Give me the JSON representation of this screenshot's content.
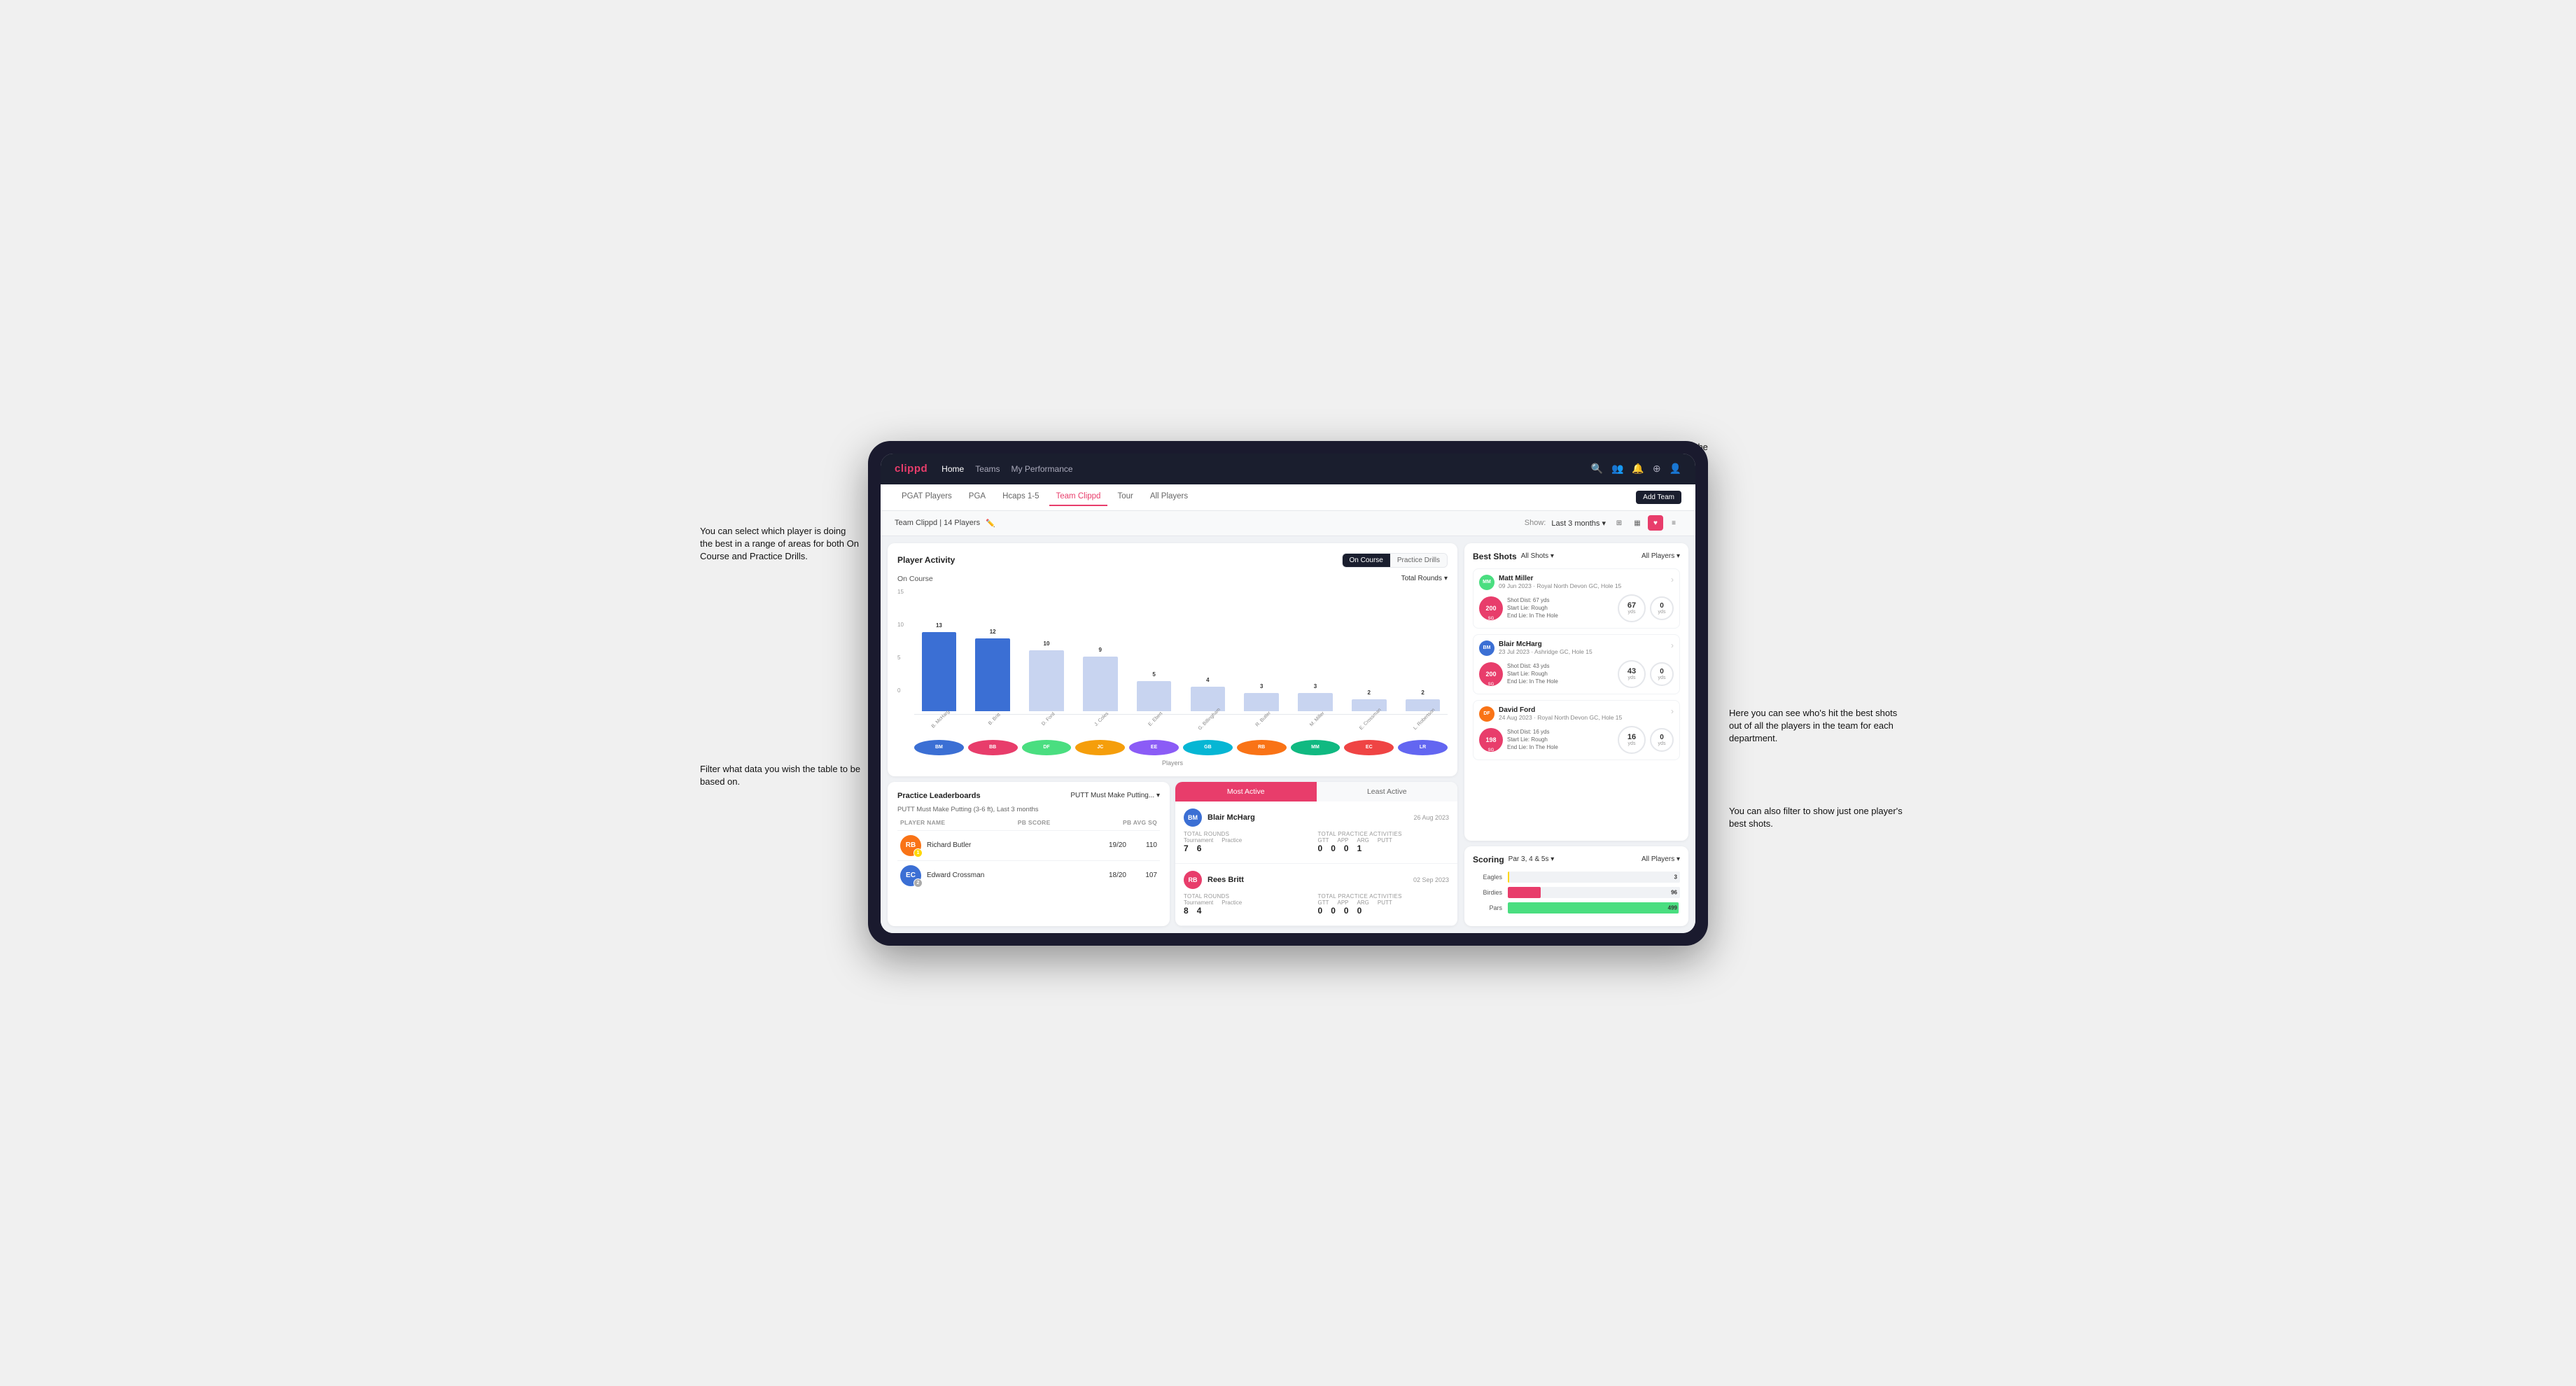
{
  "annotations": {
    "top_right": "Choose the timescale you wish to see the data over.",
    "left_top": "You can select which player is doing the best in a range of areas for both On Course and Practice Drills.",
    "left_bottom": "Filter what data you wish the table to be based on.",
    "right_mid": "Here you can see who's hit the best shots out of all the players in the team for each department.",
    "right_bottom": "You can also filter to show just one player's best shots."
  },
  "nav": {
    "logo": "clippd",
    "links": [
      "Home",
      "Teams",
      "My Performance"
    ],
    "icons": [
      "search",
      "users",
      "bell",
      "add",
      "profile"
    ]
  },
  "sub_nav": {
    "tabs": [
      "PGAT Players",
      "PGA",
      "Hcaps 1-5",
      "Team Clippd",
      "Tour",
      "All Players"
    ],
    "active_tab": "Team Clippd",
    "add_button": "Add Team"
  },
  "team_header": {
    "name": "Team Clippd",
    "player_count": "14 Players",
    "show_label": "Show:",
    "period": "Last 3 months",
    "view_icons": [
      "grid",
      "grid2",
      "heart",
      "list"
    ]
  },
  "player_activity": {
    "title": "Player Activity",
    "toggle_options": [
      "On Course",
      "Practice Drills"
    ],
    "active_toggle": "On Course",
    "section_label": "On Course",
    "metric_label": "Total Rounds",
    "x_axis_label": "Players",
    "y_labels": [
      "15",
      "10",
      "5",
      "0"
    ],
    "bars": [
      {
        "name": "B. McHarg",
        "value": 13,
        "color": "highlight",
        "initials": "BM"
      },
      {
        "name": "B. Britt",
        "value": 12,
        "color": "highlight",
        "initials": "BB"
      },
      {
        "name": "D. Ford",
        "value": 10,
        "color": "accent",
        "initials": "DF"
      },
      {
        "name": "J. Coles",
        "value": 9,
        "color": "accent",
        "initials": "JC"
      },
      {
        "name": "E. Ebert",
        "value": 5,
        "color": "accent",
        "initials": "EE"
      },
      {
        "name": "G. Billingham",
        "value": 4,
        "color": "accent",
        "initials": "GB"
      },
      {
        "name": "R. Butler",
        "value": 3,
        "color": "accent",
        "initials": "RB"
      },
      {
        "name": "M. Miller",
        "value": 3,
        "color": "accent",
        "initials": "MM"
      },
      {
        "name": "E. Crossman",
        "value": 2,
        "color": "accent",
        "initials": "EC"
      },
      {
        "name": "L. Robertson",
        "value": 2,
        "color": "accent",
        "initials": "LR"
      }
    ],
    "avatar_colors": [
      "#3b6fd4",
      "#e83d6b",
      "#4ade80",
      "#f59e0b",
      "#8b5cf6",
      "#06b6d4",
      "#f97316",
      "#10b981",
      "#ef4444",
      "#6366f1"
    ]
  },
  "practice_leaderboards": {
    "title": "Practice Leaderboards",
    "drill": "PUTT Must Make Putting...",
    "subtitle": "PUTT Must Make Putting (3-6 ft), Last 3 months",
    "columns": [
      "Player Name",
      "PB Score",
      "PB Avg SQ"
    ],
    "players": [
      {
        "name": "Richard Butler",
        "rank": 1,
        "pb_score": "19/20",
        "pb_avg": "110",
        "color": "#f97316",
        "initials": "RB"
      },
      {
        "name": "Edward Crossman",
        "rank": 2,
        "pb_score": "18/20",
        "pb_avg": "107",
        "color": "#3b6fd4",
        "initials": "EC"
      }
    ]
  },
  "most_active": {
    "tabs": [
      "Most Active",
      "Least Active"
    ],
    "active_tab": "Most Active",
    "players": [
      {
        "name": "Blair McHarg",
        "date": "26 Aug 2023",
        "color": "#3b6fd4",
        "initials": "BM",
        "total_rounds_label": "Total Rounds",
        "total_practice_label": "Total Practice Activities",
        "tournament": 7,
        "practice": 6,
        "gtt": 0,
        "app": 0,
        "arg": 0,
        "putt": 1
      },
      {
        "name": "Rees Britt",
        "date": "02 Sep 2023",
        "color": "#e83d6b",
        "initials": "RB",
        "total_rounds_label": "Total Rounds",
        "total_practice_label": "Total Practice Activities",
        "tournament": 8,
        "practice": 4,
        "gtt": 0,
        "app": 0,
        "arg": 0,
        "putt": 0
      }
    ]
  },
  "best_shots": {
    "title": "Best Shots",
    "filter_all": "All Shots",
    "filter_players": "All Players",
    "shots": [
      {
        "player_name": "Matt Miller",
        "player_detail": "09 Jun 2023 · Royal North Devon GC, Hole 15",
        "sg": "200",
        "shot_dist": "Shot Dist: 67 yds",
        "start_lie": "Start Lie: Rough",
        "end_lie": "End Lie: In The Hole",
        "dist_val": "67",
        "dist_unit": "yds",
        "carry_val": "0",
        "carry_unit": "yds",
        "color": "#4ade80",
        "initials": "MM"
      },
      {
        "player_name": "Blair McHarg",
        "player_detail": "23 Jul 2023 · Ashridge GC, Hole 15",
        "sg": "200",
        "shot_dist": "Shot Dist: 43 yds",
        "start_lie": "Start Lie: Rough",
        "end_lie": "End Lie: In The Hole",
        "dist_val": "43",
        "dist_unit": "yds",
        "carry_val": "0",
        "carry_unit": "yds",
        "color": "#3b6fd4",
        "initials": "BM"
      },
      {
        "player_name": "David Ford",
        "player_detail": "24 Aug 2023 · Royal North Devon GC, Hole 15",
        "sg": "198",
        "shot_dist": "Shot Dist: 16 yds",
        "start_lie": "Start Lie: Rough",
        "end_lie": "End Lie: In The Hole",
        "dist_val": "16",
        "dist_unit": "yds",
        "carry_val": "0",
        "carry_unit": "yds",
        "color": "#f97316",
        "initials": "DF"
      }
    ]
  },
  "scoring": {
    "title": "Scoring",
    "filter": "Par 3, 4 & 5s",
    "players_filter": "All Players",
    "bars": [
      {
        "label": "Eagles",
        "value": 3,
        "max": 500,
        "color": "eagles"
      },
      {
        "label": "Birdies",
        "value": 96,
        "max": 500,
        "color": "birdies"
      },
      {
        "label": "Pars",
        "value": 499,
        "max": 500,
        "color": "pars"
      }
    ]
  }
}
